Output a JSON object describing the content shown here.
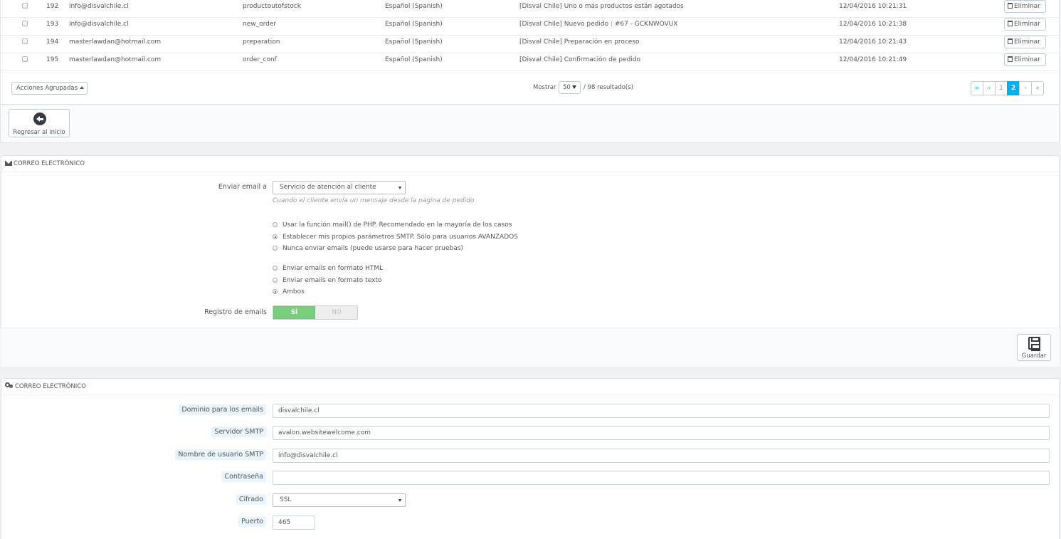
{
  "table": {
    "rows": [
      {
        "id": "192",
        "recipient": "info@disvalchile.cl",
        "template": "productoutofstock",
        "language": "Español (Spanish)",
        "subject": "[Disval Chile] Uno o más productos están agotados",
        "date": "12/04/2016 10:21:31",
        "delete_label": "Eliminar"
      },
      {
        "id": "193",
        "recipient": "info@disvalchile.cl",
        "template": "new_order",
        "language": "Español (Spanish)",
        "subject": "[Disval Chile] Nuevo pedido : #67 - GCKNWOVUX",
        "date": "12/04/2016 10:21:38",
        "delete_label": "Eliminar"
      },
      {
        "id": "194",
        "recipient": "masterlawdan@hotmail.com",
        "template": "preparation",
        "language": "Español (Spanish)",
        "subject": "[Disval Chile] Preparación en proceso",
        "date": "12/04/2016 10:21:43",
        "delete_label": "Eliminar"
      },
      {
        "id": "195",
        "recipient": "masterlawdan@hotmail.com",
        "template": "order_conf",
        "language": "Español (Spanish)",
        "subject": "[Disval Chile] Confirmación de pedido",
        "date": "12/04/2016 10:21:49",
        "delete_label": "Eliminar"
      }
    ],
    "bulk_actions_label": "Acciones Agrupadas",
    "show_label": "Mostrar",
    "show_value": "50",
    "results_label": "/ 98 resultado(s)",
    "pagination": {
      "first": "«",
      "prev": "‹",
      "pages": [
        "1",
        "2"
      ],
      "current": "2",
      "next": "›",
      "last": "»"
    }
  },
  "back_button_label": "Regresar al inicio",
  "email_panel": {
    "title": "CORREO ELECTRÓNICO",
    "send_to_label": "Enviar email a",
    "send_to_value": "Servicio de atención al cliente",
    "send_to_help": "Cuando el cliente envía un mensaje desde la página de pedido",
    "method_options": [
      {
        "label": "Usar la función mail() de PHP. Recomendado en la mayoría de los casos",
        "selected": false
      },
      {
        "label": "Establecer mis propios parámetros SMTP. Sólo para usuarios AVANZADOS",
        "selected": true
      },
      {
        "label": "Nunca enviar emails (puede usarse para hacer pruebas)",
        "selected": false
      }
    ],
    "format_options": [
      {
        "label": "Enviar emails en formato HTML",
        "selected": false
      },
      {
        "label": "Enviar emails en formato texto",
        "selected": false
      },
      {
        "label": "Ambos",
        "selected": true
      }
    ],
    "log_label": "Registro de emails",
    "log_yes": "SÍ",
    "log_no": "NO",
    "log_value": "SÍ",
    "save_label": "Guardar"
  },
  "smtp_panel": {
    "title": "CORREO ELECTRÓNICO",
    "domain_label": "Dominio para los emails",
    "domain_value": "disvalchile.cl",
    "server_label": "Servidor SMTP",
    "server_value": "avalon.websitewelcome.com",
    "user_label": "Nombre de usuario SMTP",
    "user_value": "info@disvalchile.cl",
    "password_label": "Contraseña",
    "password_value": "",
    "encryption_label": "Cifrado",
    "encryption_value": "SSL",
    "port_label": "Puerto",
    "port_value": "465"
  },
  "colors": {
    "accent": "#00aff0",
    "switch_on": "#78d07d",
    "label_pill": "#e9f4fb"
  }
}
